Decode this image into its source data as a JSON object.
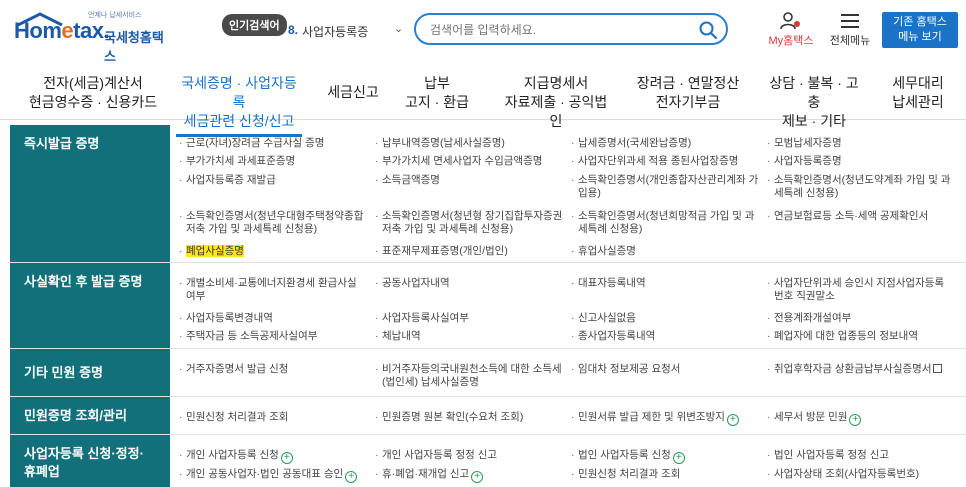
{
  "header": {
    "logo_tagline": "언제나 납세서비스",
    "logo_main_prefix": "Hom",
    "logo_main_e": "e",
    "logo_main_suffix": "tax.",
    "logo_kor": "국세청홈택스",
    "popular": {
      "badge": "인기검색어",
      "rank": "8.",
      "term": "사업자등록증"
    },
    "search": {
      "placeholder": "검색어를 입력하세요."
    },
    "my_home_label": "My홈택스",
    "all_menu_label": "전체메뉴",
    "prev_button": {
      "line1": "기존 홈택스",
      "line2": "메뉴 보기"
    }
  },
  "gnb": [
    {
      "line1": "전자(세금)계산서",
      "line2": "현금영수증 · 신용카드",
      "active": false
    },
    {
      "line1": "국세증명 · 사업자등록",
      "line2": "세금관련 신청/신고",
      "active": true
    },
    {
      "line1": "세금신고",
      "line2": "",
      "active": false
    },
    {
      "line1": "납부",
      "line2": "고지 · 환급",
      "active": false
    },
    {
      "line1": "지급명세서",
      "line2": "자료제출 · 공익법인",
      "active": false
    },
    {
      "line1": "장려금 · 연말정산",
      "line2": "전자기부금",
      "active": false
    },
    {
      "line1": "상담 · 불복 · 고충",
      "line2": "제보 · 기타",
      "active": false
    },
    {
      "line1": "세무대리",
      "line2": "납세관리",
      "active": false
    }
  ],
  "sections": [
    {
      "title": "즉시발급 증명",
      "cells": [
        [
          "근로(자녀)장려금 수급사실 증명",
          "납부내역증명(납세사실증명)",
          "납세증명서(국세완납증명)",
          "모범납세자증명"
        ],
        [
          "부가가치세 과세표준증명",
          "부가가치세 면세사업자 수입금액증명",
          "사업자단위과세 적용 종된사업장증명",
          "사업자등록증명"
        ],
        [
          "사업자등록증 재발급",
          "소득금액증명",
          "소득확인증명서(개인종합자산관리계좌 가입용)",
          "소득확인증명서(청년도약계좌 가입 및 과세특례 신청용)"
        ],
        [
          "소득확인증명서(청년우대형주택청약종합저축 가입 및 과세특례 신청용)",
          "소득확인증명서(청년형 장기집합투자증권저축 가입 및 과세특례 신청용)",
          "소득확인증명서(청년희망적금 가입 및 과세특례 신청용)",
          "연금보험료등 소득·세액 공제확인서"
        ],
        [
          "폐업사실증명",
          "표준재무제표증명(개인/법인)",
          "휴업사실증명",
          ""
        ]
      ]
    },
    {
      "title": "사실확인 후 발급 증명",
      "cells": [
        [
          "개별소비세·교통에너지환경세 환급사실 여부",
          "공동사업자내역",
          "대표자등록내역",
          "사업자단위과세 승인시 지점사업자등록 번호 직권말소"
        ],
        [
          "사업자등록변경내역",
          "사업자등록사실여부",
          "신고사실없음",
          "전용계좌개설여부"
        ],
        [
          "주택자금 등 소득공제사실여부",
          "체납내역",
          "종사업자등록내역",
          "폐업자에 대한 업종등의 정보내역"
        ]
      ]
    },
    {
      "title": "기타 민원 증명",
      "cells": [
        [
          "거주자증명서 발급 신청",
          "비거주자등의국내원천소득에 대한 소득세(법인세) 납세사실증명",
          "임대차 정보제공 요청서",
          "취업후학자금 상환금납부사실증명서"
        ]
      ]
    },
    {
      "title": "민원증명 조회/관리",
      "cells": [
        [
          "민원신청 처리결과 조회",
          "민원증명 원본 확인(수요처 조회)",
          "민원서류 발급 제한 및 위변조방지",
          "세무서 방문 민원"
        ]
      ]
    },
    {
      "title": "사업자등록 신청·정정·휴폐업",
      "title_line1": "사업자등록 신청·정정·",
      "title_line2": "휴폐업",
      "cells": [
        [
          "개인 사업자등록 신청",
          "개인 사업자등록 정정 신고",
          "법인 사업자등록 신청",
          "법인 사업자등록 정정 신고"
        ],
        [
          "개인 공동사업자·법인 공동대표 승인",
          "휴·폐업·재개업 신고",
          "민원신청 처리결과 조회",
          "사업자상태 조회(사업자등록번호)"
        ]
      ]
    }
  ],
  "colors": {
    "accent": "#1b73c7",
    "row_head": "#11707a",
    "highlight": "#ffe81a",
    "plus": "#2a9a5a",
    "my_home": "#d23a3a"
  }
}
